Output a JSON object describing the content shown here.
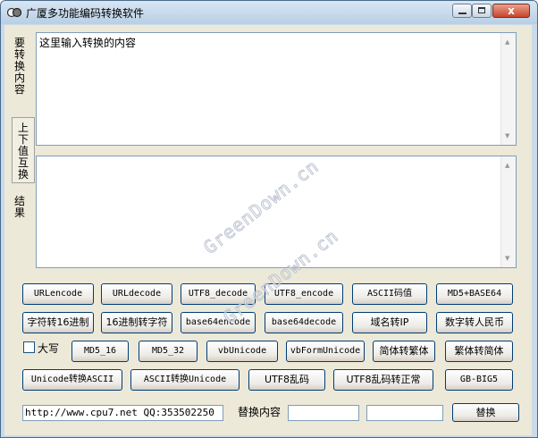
{
  "window": {
    "title": "广厦多功能编码转换软件",
    "icons": {
      "app": "app-icon",
      "minimize": "minimize-icon",
      "maximize": "maximize-icon",
      "close": "close-icon"
    },
    "close_glyph": "x"
  },
  "labels": {
    "input": "要转换内容",
    "swap": "上下值互换",
    "result": "结果",
    "uppercase": "大写",
    "replace": "替换内容"
  },
  "input_area": {
    "value": "这里输入转换的内容"
  },
  "result_area": {
    "value": ""
  },
  "buttons": {
    "row1": [
      "URLencode",
      "URLdecode",
      "UTF8_decode",
      "UTF8_encode",
      "ASCII码值",
      "MD5+BASE64"
    ],
    "row2": [
      "字符转16进制",
      "16进制转字符",
      "base64encode",
      "base64decode",
      "域名转IP",
      "数字转人民币"
    ],
    "row3": [
      "MD5_16",
      "MD5_32",
      "vbUnicode",
      "vbFormUnicode",
      "简体转繁体",
      "繁体转简体"
    ],
    "row4": [
      "Unicode转换ASCII",
      "ASCII转换Unicode",
      "UTF8乱码",
      "UTF8乱码转正常",
      "GB-BIG5"
    ],
    "replace": "替换"
  },
  "fields": {
    "url": "http://www.cpu7.net QQ:353502250",
    "find": "",
    "replace_with": ""
  },
  "watermark": "GreenDown.cn",
  "colors": {
    "title_bar": "#c9daea",
    "client": "#ece9d8",
    "close_button": "#c9452b"
  }
}
